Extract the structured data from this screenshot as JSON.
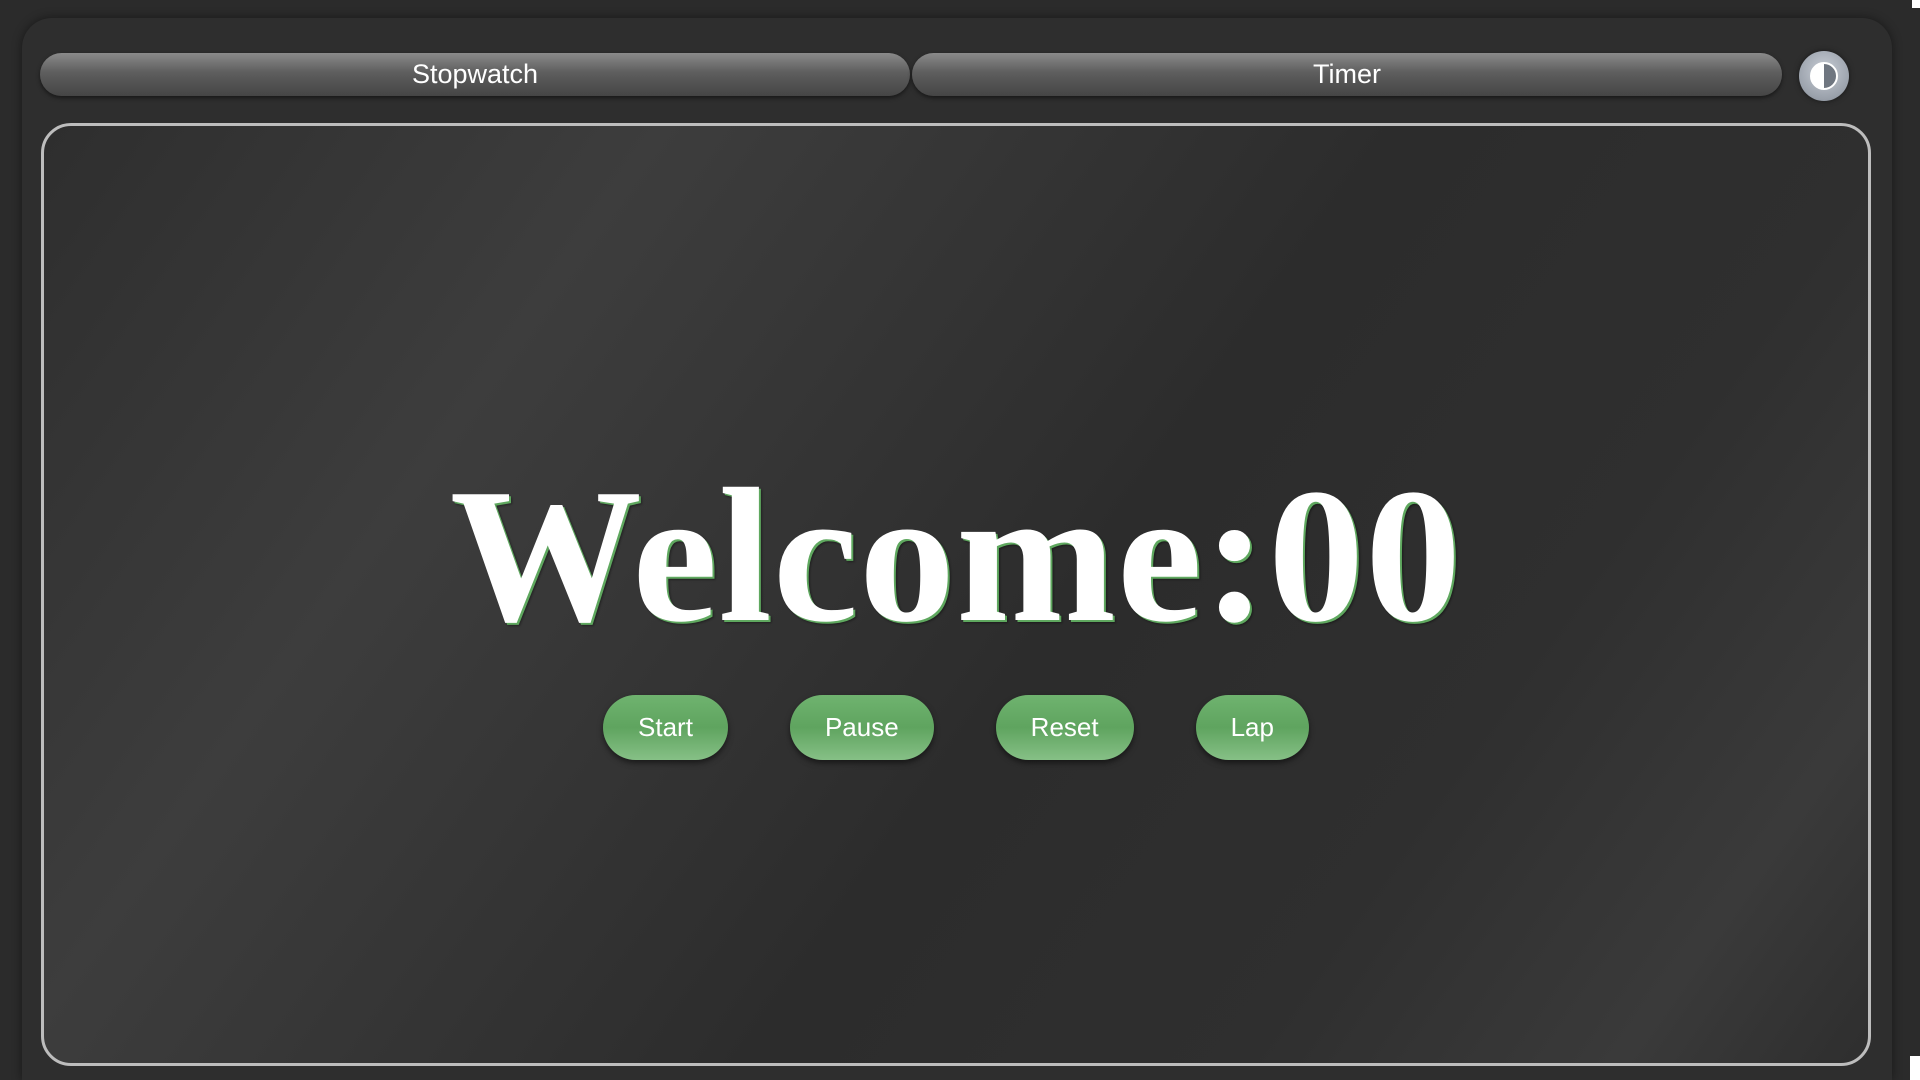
{
  "tabs": {
    "stopwatch_label": "Stopwatch",
    "timer_label": "Timer"
  },
  "theme_toggle": {
    "icon": "contrast-icon"
  },
  "display": {
    "text": "Welcome:00"
  },
  "controls": {
    "start_label": "Start",
    "pause_label": "Pause",
    "reset_label": "Reset",
    "lap_label": "Lap"
  },
  "colors": {
    "background": "#2b2b2b",
    "accent_green": "#6fb36f",
    "panel_border": "#bdbdbd",
    "text": "#ffffff"
  }
}
